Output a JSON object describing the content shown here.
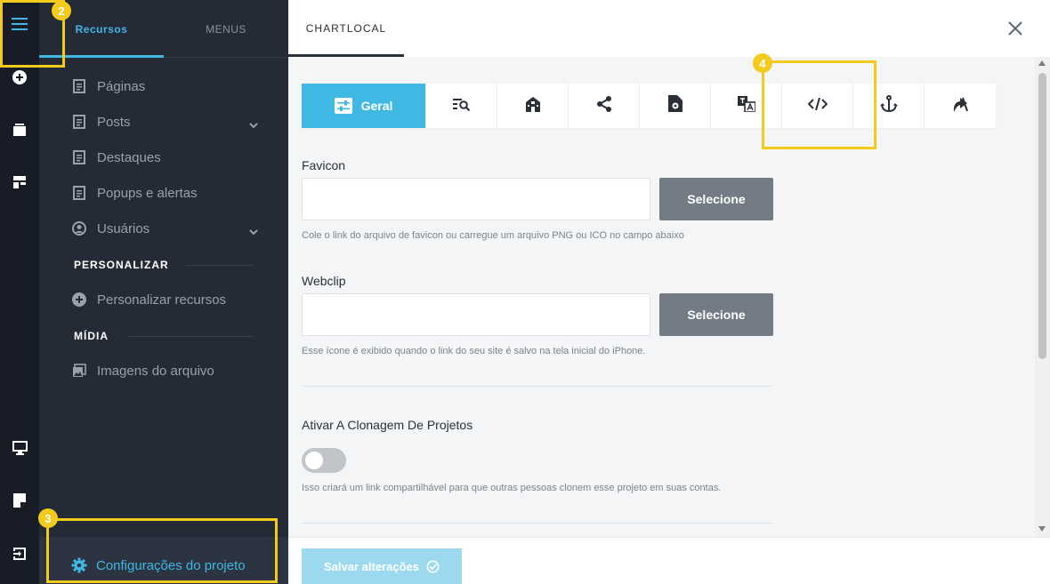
{
  "sidebar": {
    "tabs": [
      {
        "label": "Recursos"
      },
      {
        "label": "MENUS"
      }
    ],
    "items": [
      {
        "label": "Páginas",
        "icon": "document-icon"
      },
      {
        "label": "Posts",
        "icon": "document-icon"
      },
      {
        "label": "Destaques",
        "icon": "document-icon"
      },
      {
        "label": "Popups e alertas",
        "icon": "document-icon"
      },
      {
        "label": "Usuários",
        "icon": "user-circle-icon"
      }
    ],
    "sections": {
      "personalizar": "PERSONALIZAR",
      "midia": "MÍDIA"
    },
    "personalizar_item": "Personalizar recursos",
    "midia_item": "Imagens do arquivo",
    "footer_item": "Configurações do projeto"
  },
  "main": {
    "title": "CHARTLOCAL",
    "active_tab_label": "Geral",
    "tab_icons": [
      "sliders-icon",
      "search-list-icon",
      "building-icon",
      "share-icon",
      "file-gear-icon",
      "translate-icon",
      "code-icon",
      "anchor-icon",
      "redirect-icon"
    ],
    "favicon": {
      "label": "Favicon",
      "value": "",
      "button": "Selecione",
      "help": "Cole o link do arquivo de favicon ou carregue um arquivo PNG ou ICO no campo abaixo"
    },
    "webclip": {
      "label": "Webclip",
      "value": "",
      "button": "Selecione",
      "help": "Esse ícone é exibido quando o link do seu site é salvo na tela inicial do iPhone."
    },
    "cloning": {
      "label": "Ativar A Clonagem De Projetos",
      "enabled": false,
      "help": "Isso criará um link compartilhável para que outras pessoas clonem esse projeto em suas contas."
    },
    "save_label": "Salvar alterações"
  },
  "annotations": [
    "2",
    "3",
    "4"
  ],
  "colors": {
    "accent": "#3fb8e4",
    "highlight": "#f2cb1d",
    "rail": "#171c27",
    "sidebar": "#242a36"
  }
}
